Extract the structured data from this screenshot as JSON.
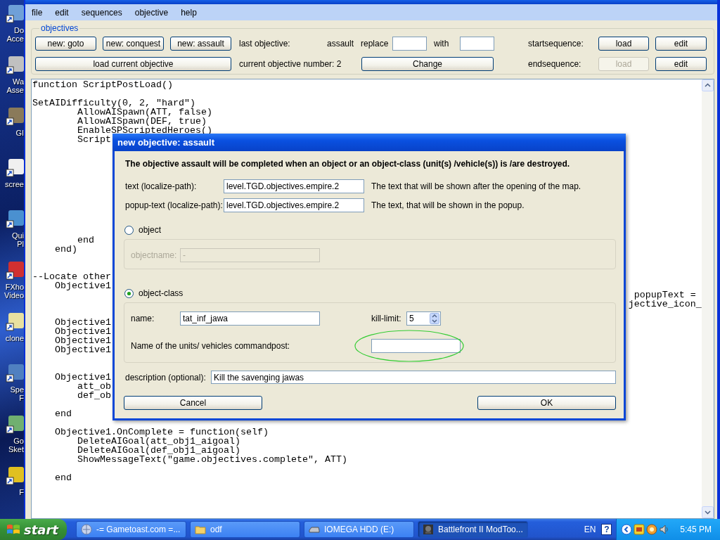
{
  "desktop_icons": [
    {
      "lines": [
        "Do",
        "Acce"
      ]
    },
    {
      "lines": [
        "Wa",
        "Asse"
      ]
    },
    {
      "lines": [
        "GI"
      ]
    },
    {
      "lines": [
        "scree"
      ]
    },
    {
      "lines": [
        "Qui",
        "Pl"
      ]
    },
    {
      "lines": [
        "FXho",
        "Video"
      ]
    },
    {
      "lines": [
        "clone"
      ]
    },
    {
      "lines": [
        "Spe",
        "F"
      ]
    },
    {
      "lines": [
        "Go",
        "Sket"
      ]
    },
    {
      "lines": [
        "F"
      ]
    }
  ],
  "menu": [
    "file",
    "edit",
    "sequences",
    "objective",
    "help"
  ],
  "objectives": {
    "title": "objectives",
    "rows": [
      {
        "items": [
          {
            "kind": "button",
            "label": "new: goto",
            "disabled": false
          },
          {
            "kind": "button",
            "label": "new: conquest",
            "disabled": false
          },
          {
            "kind": "button",
            "label": "new: assault",
            "disabled": false
          },
          {
            "kind": "label",
            "label": "last objective:"
          },
          {
            "kind": "label",
            "label": "assault"
          },
          {
            "kind": "label",
            "label": "replace"
          },
          {
            "kind": "input"
          },
          {
            "kind": "label",
            "label": "with"
          },
          {
            "kind": "input"
          },
          {
            "kind": "label",
            "label": "startsequence:"
          },
          {
            "kind": "button",
            "label": "load",
            "disabled": false
          },
          {
            "kind": "button",
            "label": "edit",
            "disabled": false
          }
        ]
      },
      {
        "items": [
          {
            "kind": "button",
            "label": "load current objective",
            "disabled": false
          },
          {
            "kind": "label",
            "label": "current objective number: 2"
          },
          {
            "kind": "button",
            "label": "Change",
            "disabled": false
          },
          {
            "kind": "label",
            "label": "endsequence:"
          },
          {
            "kind": "button",
            "label": "load",
            "disabled": true
          },
          {
            "kind": "button",
            "label": "edit",
            "disabled": false
          }
        ]
      }
    ]
  },
  "code": "function ScriptPostLoad()\n\nSetAIDifficulty(0, 2, \"hard\")\n        AllowAISpawn(ATT, false)\n        AllowAISpawn(DEF, true)\n        EnableSPScriptedHeroes()\n        Script\n\n\n\n\n\n\n\n\n\n\n        end\n    end)\n\n\n--Locate other\n    Objective1\n                                                                                                           popupText =\n                                                                                                          jective_icon_\n\n    Objective1\n    Objective1\n    Objective1\n    Objective1\n\n\n    Objective1\n        att_ob\n        def_ob\n\n    end\n\n    Objective1.OnComplete = function(self)\n        DeleteAIGoal(att_obj1_aigoal)\n        DeleteAIGoal(def_obj1_aigoal)\n        ShowMessageText(\"game.objectives.complete\", ATT)\n\n    end",
  "dialog": {
    "title": "new objective: assault",
    "intro": "The objective assault will be completed when an object or an object-class (unit(s) /vehicle(s)) is /are destroyed.",
    "fields": [
      {
        "label": "text (localize-path):",
        "value": "level.TGD.objectives.empire.2",
        "hint": "The text that will be shown after the opening of the map."
      },
      {
        "label": "popup-text (localize-path):",
        "value": "level.TGD.objectives.empire.2",
        "hint": "The text, that will be shown in the popup."
      }
    ],
    "options": [
      {
        "label": "object",
        "selected": false,
        "rows": [
          [
            {
              "kind": "field",
              "label": "objectname:",
              "value": "-"
            }
          ]
        ]
      },
      {
        "label": "object-class",
        "selected": true,
        "rows": [
          [
            {
              "kind": "field",
              "label": "name:",
              "value": "tat_inf_jawa"
            },
            {
              "kind": "spinner",
              "label": "kill-limit:",
              "value": "5"
            }
          ],
          [
            {
              "kind": "field",
              "label": "Name of the units/ vehicles commandpost:",
              "highlighted": true
            }
          ]
        ]
      }
    ],
    "description": {
      "label": "description (optional):",
      "value": "Kill the savenging jawas"
    },
    "buttons": [
      "Cancel",
      "OK"
    ]
  },
  "taskbar": {
    "start": "start",
    "tasks": [
      {
        "label": "-= Gametoast.com =...",
        "selected": false
      },
      {
        "label": "odf",
        "selected": false
      },
      {
        "label": "IOMEGA HDD (E:)",
        "selected": false
      },
      {
        "label": "Battlefront II ModToo...",
        "selected": true
      }
    ],
    "language": "EN",
    "help": "?",
    "clock": "5:45 PM"
  }
}
